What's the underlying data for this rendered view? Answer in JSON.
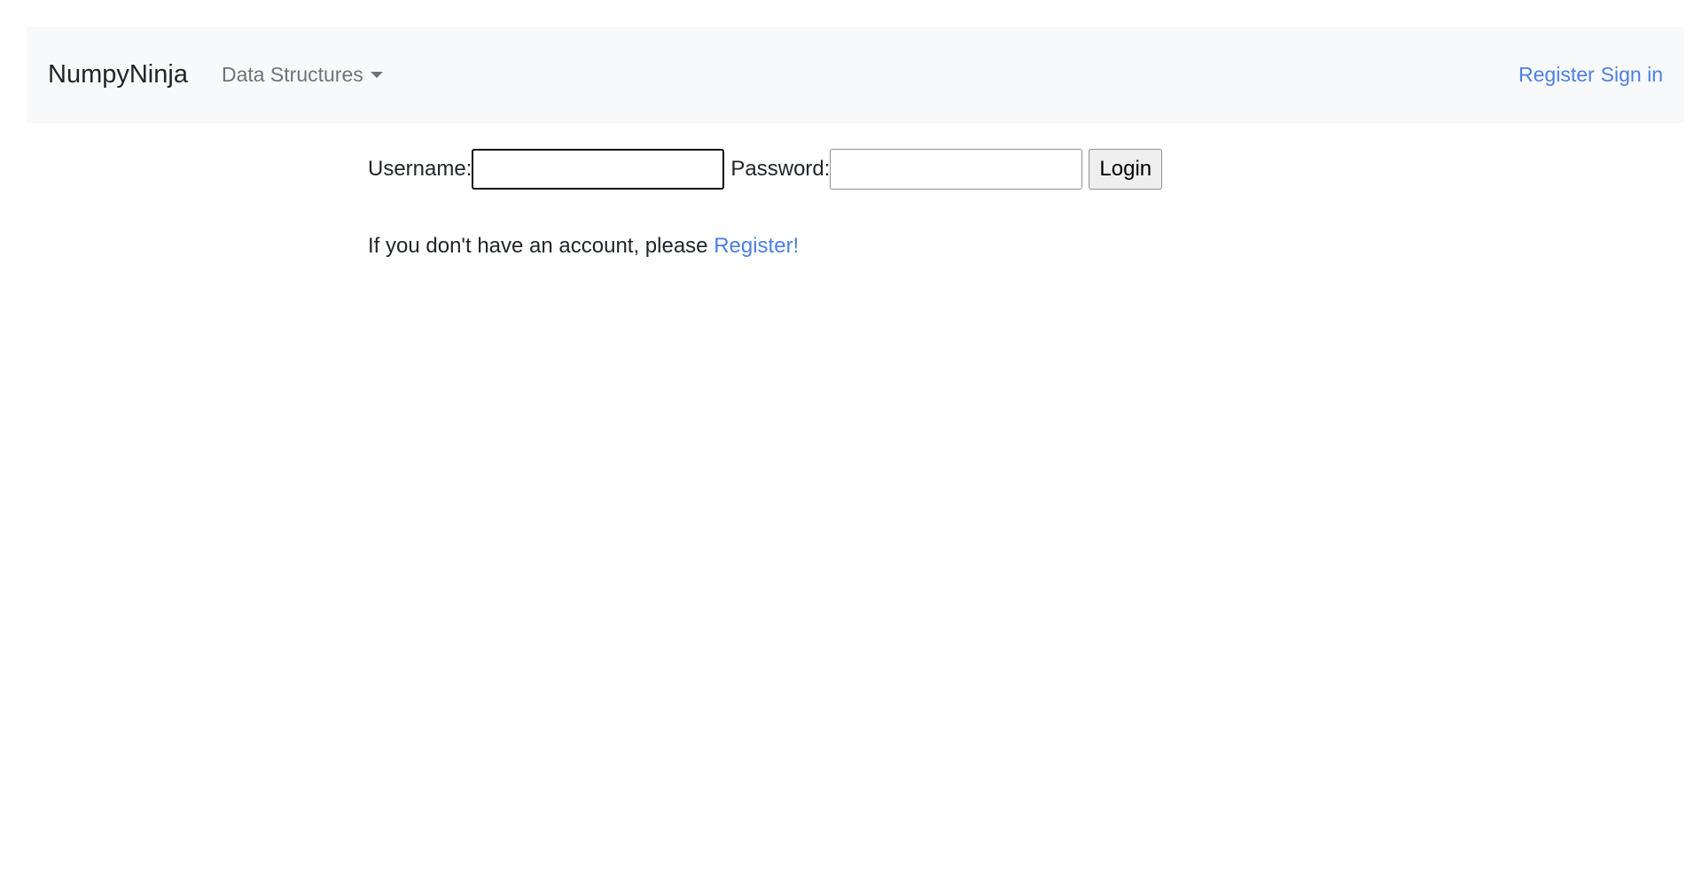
{
  "navbar": {
    "brand": "NumpyNinja",
    "dropdown_label": "Data Structures",
    "dropdown_icon": "caret-down-icon",
    "register_label": "Register",
    "signin_label": "Sign in"
  },
  "login_form": {
    "username_label": "Username:",
    "username_value": "",
    "password_label": "Password:",
    "password_value": "",
    "submit_label": "Login"
  },
  "register_prompt": {
    "text": "If you don't have an account, please ",
    "link_label": "Register!"
  },
  "colors": {
    "navbar_bg": "#f8f9fa",
    "link": "#4c7fe1",
    "muted_nav": "#737373"
  }
}
